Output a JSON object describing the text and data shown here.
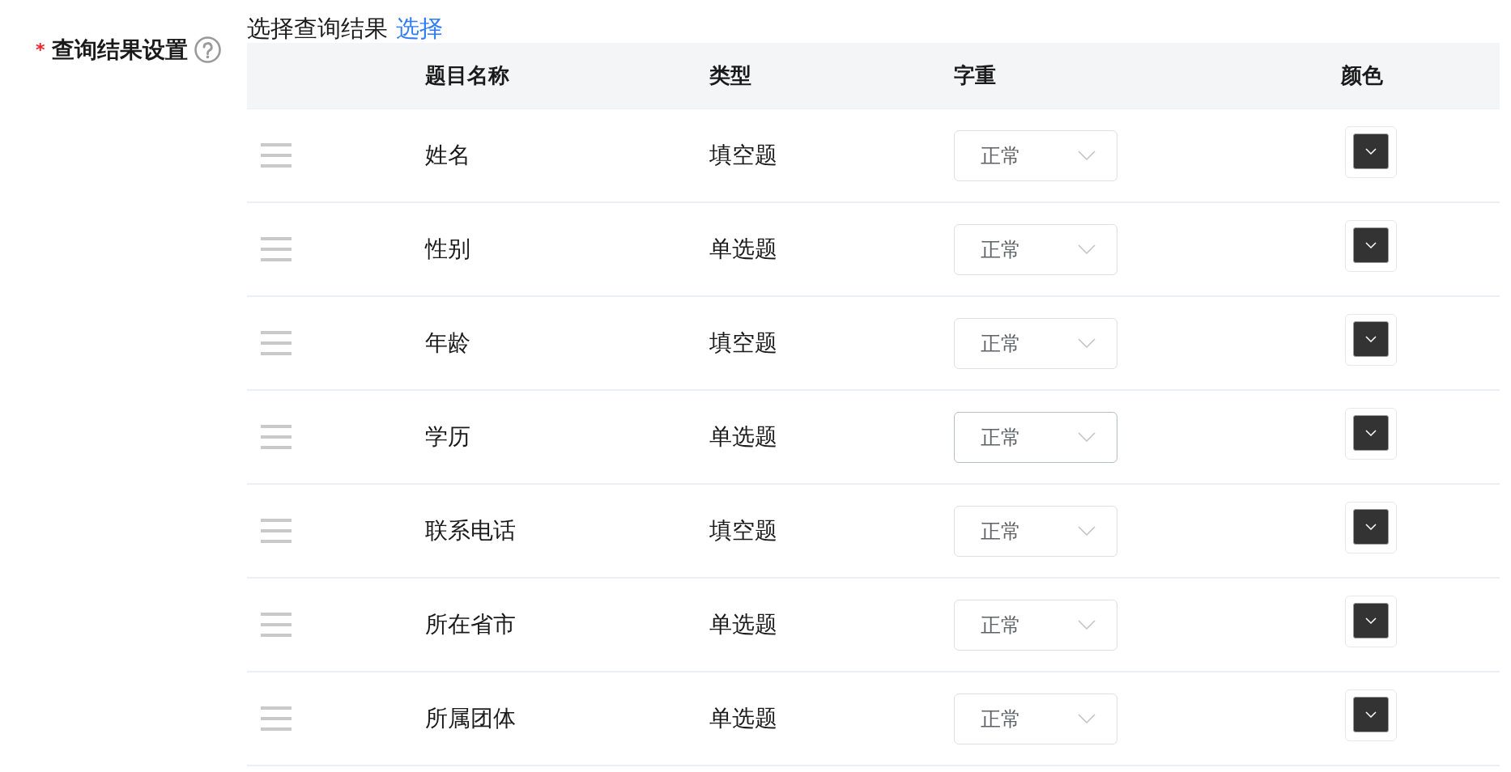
{
  "form_item": {
    "required_mark": "*",
    "label": "查询结果设置",
    "help": true
  },
  "selector": {
    "text": "选择查询结果",
    "link": "选择"
  },
  "table": {
    "columns": [
      "题目名称",
      "类型",
      "字重",
      "颜色"
    ],
    "rows": [
      {
        "name": "姓名",
        "type": "填空题",
        "weight": {
          "value": "正常",
          "hovered": false
        },
        "color": "#333333"
      },
      {
        "name": "性别",
        "type": "单选题",
        "weight": {
          "value": "正常",
          "hovered": false
        },
        "color": "#333333"
      },
      {
        "name": "年龄",
        "type": "填空题",
        "weight": {
          "value": "正常",
          "hovered": false
        },
        "color": "#333333"
      },
      {
        "name": "学历",
        "type": "单选题",
        "weight": {
          "value": "正常",
          "hovered": true
        },
        "color": "#333333"
      },
      {
        "name": "联系电话",
        "type": "填空题",
        "weight": {
          "value": "正常",
          "hovered": false
        },
        "color": "#333333"
      },
      {
        "name": "所在省市",
        "type": "单选题",
        "weight": {
          "value": "正常",
          "hovered": false
        },
        "color": "#333333"
      },
      {
        "name": "所属团体",
        "type": "单选题",
        "weight": {
          "value": "正常",
          "hovered": false
        },
        "color": "#333333"
      }
    ]
  }
}
